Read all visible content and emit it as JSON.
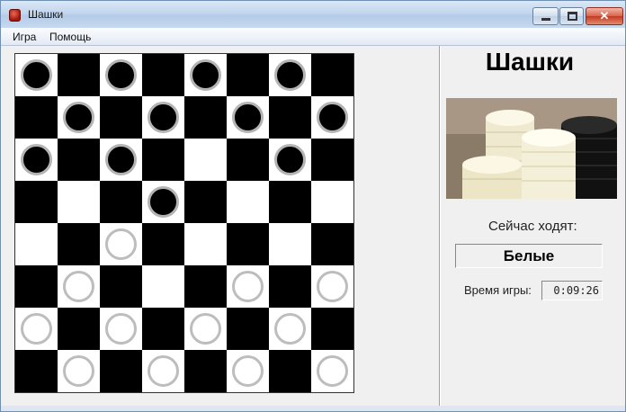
{
  "window": {
    "title": "Шашки",
    "close_glyph": "✕"
  },
  "menu": {
    "game_label": "Игра",
    "help_label": "Помощь"
  },
  "board": {
    "size": 8,
    "rows": [
      [
        "B",
        "",
        "B",
        "",
        "B",
        "",
        "B",
        ""
      ],
      [
        "",
        "B",
        "",
        "B",
        "",
        "B",
        "",
        "B"
      ],
      [
        "B",
        "",
        "B",
        "",
        "",
        "",
        "B",
        ""
      ],
      [
        "",
        "",
        "",
        "B",
        "",
        "",
        "",
        ""
      ],
      [
        "",
        "",
        "W",
        "",
        "",
        "",
        "",
        ""
      ],
      [
        "",
        "W",
        "",
        "",
        "",
        "W",
        "",
        "W"
      ],
      [
        "W",
        "",
        "W",
        "",
        "W",
        "",
        "W",
        ""
      ],
      [
        "",
        "W",
        "",
        "W",
        "",
        "W",
        "",
        "W"
      ]
    ]
  },
  "side": {
    "game_title": "Шашки",
    "turn_caption": "Сейчас ходят:",
    "turn_value": "Белые",
    "time_label": "Время игры:",
    "time_value": "0:09:26"
  },
  "icons": {
    "app": "checkers-app-icon",
    "minimize": "minimize-icon",
    "maximize": "maximize-icon",
    "close": "close-icon"
  }
}
